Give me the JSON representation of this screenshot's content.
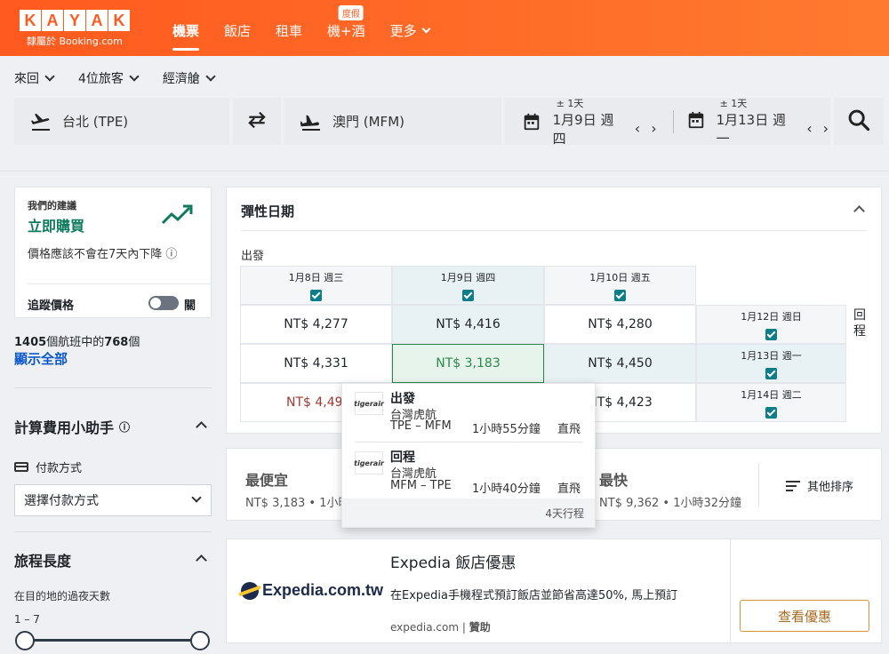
{
  "header": {
    "logo_letters": [
      "K",
      "A",
      "Y",
      "A",
      "K"
    ],
    "logo_sub": "隸屬於 Booking.com",
    "nav": [
      {
        "label": "機票",
        "active": true
      },
      {
        "label": "飯店"
      },
      {
        "label": "租車"
      },
      {
        "label": "機+酒",
        "badge": "度假"
      },
      {
        "label": "更多"
      }
    ]
  },
  "search_options": {
    "trip_type": "來回",
    "travelers": "4位旅客",
    "cabin": "經濟艙"
  },
  "search": {
    "origin": "台北 (TPE)",
    "destination": "澳門 (MFM)",
    "depart_flex": "± 1天",
    "depart_date": "1月9日 週四",
    "return_flex": "± 1天",
    "return_date": "1月13日 週一",
    "prev_arrow": "‹",
    "next_arrow": "›"
  },
  "recommendation": {
    "label": "我們的建議",
    "title": "立即購買",
    "desc": "價格應該不會在7天內下降",
    "info_icon": "ⓘ",
    "track_label": "追蹤價格",
    "toggle_state": "關"
  },
  "results": {
    "total": "1405",
    "mid": "個航班中的",
    "shown": "768",
    "suffix": "個",
    "show_all": "顯示全部"
  },
  "fee_helper": {
    "title": "計算費用小助手",
    "info_icon": "ⓘ",
    "payment_label": "付款方式",
    "payment_select": "選擇付款方式"
  },
  "trip_length": {
    "title": "旅程長度",
    "nights_label": "在目的地的過夜天數",
    "range": "1 – 7"
  },
  "flex_dates": {
    "title": "彈性日期",
    "depart_label": "出發",
    "return_label": "回程",
    "depart_cols": [
      "1月8日 週三",
      "1月9日 週四",
      "1月10日 週五"
    ],
    "return_rows": [
      "1月12日 週日",
      "1月13日 週一",
      "1月14日 週二"
    ],
    "prices": [
      [
        "NT$ 4,277",
        "NT$ 4,416",
        "NT$ 4,280"
      ],
      [
        "NT$ 4,331",
        "NT$ 3,183",
        "NT$ 4,450"
      ],
      [
        "NT$ 4,49",
        "",
        "NT$ 4,423"
      ]
    ]
  },
  "tooltip": {
    "outbound": {
      "title": "出發",
      "airline": "台灣虎航",
      "route": "TPE – MFM",
      "duration": "1小時55分鐘",
      "stops": "直飛",
      "logo_text": "tigerair"
    },
    "inbound": {
      "title": "回程",
      "airline": "台灣虎航",
      "route": "MFM – TPE",
      "duration": "1小時40分鐘",
      "stops": "直飛",
      "logo_text": "tigerair"
    },
    "footer": "4天行程"
  },
  "sort": {
    "cheapest_title": "最便宜",
    "cheapest_sub": "NT$ 3,183 • 1小時",
    "fastest_title": "最快",
    "fastest_sub": "NT$ 9,362 • 1小時32分鐘",
    "other": "其他排序"
  },
  "ad": {
    "brand": "Expedia.com.tw",
    "title": "Expedia 飯店優惠",
    "desc": "在Expedia手機程式預訂飯店並節省高達50%, 馬上預訂",
    "source": "expedia.com",
    "sponsored": "贊助",
    "button": "查看優惠"
  },
  "colors": {
    "brand": "#ff5a1f",
    "accent_green": "#0f7b5e",
    "link": "#0a58ca",
    "checkbox": "#0e7d8a"
  }
}
